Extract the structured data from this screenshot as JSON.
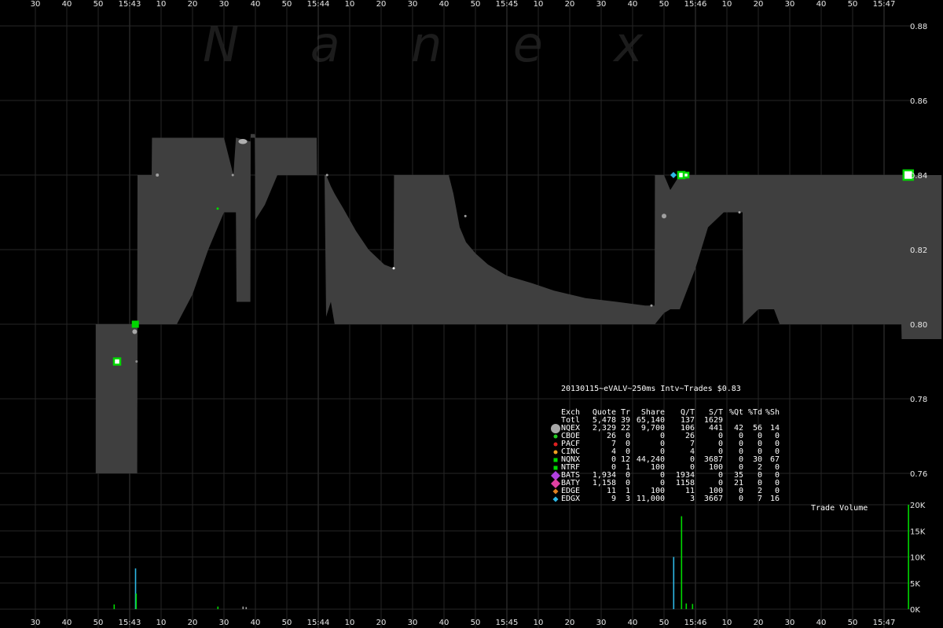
{
  "chart_data": [
    {
      "type": "area",
      "watermark": "N a n e x",
      "x_tick_labels": [
        "30",
        "40",
        "50",
        "15:43",
        "10",
        "20",
        "30",
        "40",
        "50",
        "15:44",
        "10",
        "20",
        "30",
        "40",
        "50",
        "15:45",
        "10",
        "20",
        "30",
        "40",
        "50",
        "15:46",
        "10",
        "20",
        "30",
        "40",
        "50",
        "15:47"
      ],
      "y_tick_labels": [
        "0.88",
        "0.86",
        "0.84",
        "0.82",
        "0.80",
        "0.78",
        "0.76"
      ],
      "ylim": [
        0.755,
        0.882
      ],
      "x_range_seconds": [
        -15,
        260
      ],
      "grid": true,
      "colors": {
        "band": "#3f3f3f",
        "grid": "#2a2a2a",
        "background": "#000000"
      },
      "nbbo_series": [
        {
          "t": -10.8,
          "bid": 0.76,
          "ask": 0.8
        },
        {
          "t": 2.4,
          "bid": 0.76,
          "ask": 0.8
        },
        {
          "t": 2.5,
          "bid": 0.8,
          "ask": 0.84
        },
        {
          "t": 7.0,
          "bid": 0.8,
          "ask": 0.84
        },
        {
          "t": 7.1,
          "bid": 0.8,
          "ask": 0.85
        },
        {
          "t": 15.0,
          "bid": 0.8,
          "ask": 0.85
        },
        {
          "t": 20.0,
          "bid": 0.808,
          "ask": 0.85
        },
        {
          "t": 25.0,
          "bid": 0.82,
          "ask": 0.85
        },
        {
          "t": 29.0,
          "bid": 0.828,
          "ask": 0.85
        },
        {
          "t": 30.0,
          "bid": 0.83,
          "ask": 0.85
        },
        {
          "t": 33.0,
          "bid": 0.83,
          "ask": 0.84
        },
        {
          "t": 33.8,
          "bid": 0.83,
          "ask": 0.85
        },
        {
          "t": 34.0,
          "bid": 0.806,
          "ask": 0.85
        },
        {
          "t": 38.4,
          "bid": 0.806,
          "ask": 0.849
        },
        {
          "t": 38.5,
          "bid": 0.85,
          "ask": 0.851
        },
        {
          "t": 39.8,
          "bid": 0.85,
          "ask": 0.851
        },
        {
          "t": 40.0,
          "bid": 0.828,
          "ask": 0.85
        },
        {
          "t": 43.0,
          "bid": 0.832,
          "ask": 0.85
        },
        {
          "t": 46.0,
          "bid": 0.838,
          "ask": 0.85
        },
        {
          "t": 47.0,
          "bid": 0.84,
          "ask": 0.85
        },
        {
          "t": 59.5,
          "bid": 0.84,
          "ask": 0.85
        },
        {
          "t": 59.6,
          "bid": 0.84,
          "ask": 0.84
        },
        {
          "t": 62.0,
          "bid": 0.84,
          "ask": 0.84
        },
        {
          "t": 62.5,
          "bid": 0.802,
          "ask": 0.84
        },
        {
          "t": 64.0,
          "bid": 0.806,
          "ask": 0.837
        },
        {
          "t": 65.2,
          "bid": 0.8,
          "ask": 0.835
        },
        {
          "t": 68.0,
          "bid": 0.8,
          "ask": 0.831
        },
        {
          "t": 72.0,
          "bid": 0.8,
          "ask": 0.825
        },
        {
          "t": 76.0,
          "bid": 0.8,
          "ask": 0.82
        },
        {
          "t": 81.0,
          "bid": 0.8,
          "ask": 0.816
        },
        {
          "t": 84.0,
          "bid": 0.8,
          "ask": 0.815
        },
        {
          "t": 84.1,
          "bid": 0.8,
          "ask": 0.84
        },
        {
          "t": 90.0,
          "bid": 0.8,
          "ask": 0.84
        },
        {
          "t": 95.0,
          "bid": 0.8,
          "ask": 0.84
        },
        {
          "t": 99.0,
          "bid": 0.8,
          "ask": 0.84
        },
        {
          "t": 101.5,
          "bid": 0.8,
          "ask": 0.84
        },
        {
          "t": 103.0,
          "bid": 0.8,
          "ask": 0.835
        },
        {
          "t": 105.0,
          "bid": 0.8,
          "ask": 0.826
        },
        {
          "t": 107.0,
          "bid": 0.8,
          "ask": 0.822
        },
        {
          "t": 110.0,
          "bid": 0.8,
          "ask": 0.819
        },
        {
          "t": 114.0,
          "bid": 0.8,
          "ask": 0.816
        },
        {
          "t": 120.0,
          "bid": 0.8,
          "ask": 0.813
        },
        {
          "t": 128.0,
          "bid": 0.8,
          "ask": 0.811
        },
        {
          "t": 135.0,
          "bid": 0.8,
          "ask": 0.809
        },
        {
          "t": 145.0,
          "bid": 0.8,
          "ask": 0.807
        },
        {
          "t": 155.0,
          "bid": 0.8,
          "ask": 0.806
        },
        {
          "t": 164.0,
          "bid": 0.8,
          "ask": 0.805
        },
        {
          "t": 167.0,
          "bid": 0.8,
          "ask": 0.805
        },
        {
          "t": 167.1,
          "bid": 0.8,
          "ask": 0.84
        },
        {
          "t": 170.0,
          "bid": 0.803,
          "ask": 0.84
        },
        {
          "t": 172.0,
          "bid": 0.804,
          "ask": 0.836
        },
        {
          "t": 175.0,
          "bid": 0.804,
          "ask": 0.84
        },
        {
          "t": 180.0,
          "bid": 0.815,
          "ask": 0.84
        },
        {
          "t": 184.0,
          "bid": 0.826,
          "ask": 0.84
        },
        {
          "t": 189.0,
          "bid": 0.83,
          "ask": 0.84
        },
        {
          "t": 195.0,
          "bid": 0.83,
          "ask": 0.84
        },
        {
          "t": 195.1,
          "bid": 0.8,
          "ask": 0.84
        },
        {
          "t": 200.0,
          "bid": 0.804,
          "ask": 0.84
        },
        {
          "t": 205.0,
          "bid": 0.804,
          "ask": 0.84
        },
        {
          "t": 206.8,
          "bid": 0.8,
          "ask": 0.84
        },
        {
          "t": 245.5,
          "bid": 0.8,
          "ask": 0.84
        },
        {
          "t": 245.6,
          "bid": 0.796,
          "ask": 0.84
        },
        {
          "t": 258.3,
          "bid": 0.796,
          "ask": 0.84
        }
      ],
      "trade_markers": [
        {
          "t": 1.8,
          "price": 0.8,
          "shape": "square",
          "color": "#00d800",
          "size": 9
        },
        {
          "t": 1.6,
          "price": 0.798,
          "shape": "circle",
          "color": "#a8a8a8",
          "size": 6
        },
        {
          "t": -4.0,
          "price": 0.79,
          "shape": "hollow-square",
          "color": "#00d800",
          "size": 8
        },
        {
          "t": 2.2,
          "price": 0.79,
          "shape": "circle",
          "color": "#909090",
          "size": 3
        },
        {
          "t": 8.8,
          "price": 0.84,
          "shape": "circle",
          "color": "#a0a0a0",
          "size": 4
        },
        {
          "t": 28.0,
          "price": 0.831,
          "shape": "circle",
          "color": "#00d800",
          "size": 3
        },
        {
          "t": 32.8,
          "price": 0.84,
          "shape": "circle",
          "color": "#a0a0a0",
          "size": 3
        },
        {
          "t": 36.0,
          "price": 0.849,
          "shape": "ellipse",
          "color": "#b0b0b0",
          "size": 8
        },
        {
          "t": 62.8,
          "price": 0.84,
          "shape": "circle",
          "color": "#a0a0a0",
          "size": 3
        },
        {
          "t": 84.0,
          "price": 0.815,
          "shape": "circle",
          "color": "#ffffff",
          "size": 3
        },
        {
          "t": 106.8,
          "price": 0.829,
          "shape": "circle",
          "color": "#a0a0a0",
          "size": 3
        },
        {
          "t": 166.0,
          "price": 0.805,
          "shape": "circle",
          "color": "#a0a0a0",
          "size": 3
        },
        {
          "t": 170.0,
          "price": 0.829,
          "shape": "circle",
          "color": "#a0a0a0",
          "size": 6
        },
        {
          "t": 173.0,
          "price": 0.84,
          "shape": "diamond",
          "color": "#2eb8e6",
          "size": 8
        },
        {
          "t": 175.5,
          "price": 0.84,
          "shape": "hollow-square",
          "color": "#00d800",
          "size": 8
        },
        {
          "t": 177.0,
          "price": 0.84,
          "shape": "hollow-square",
          "color": "#00d800",
          "size": 6
        },
        {
          "t": 194.0,
          "price": 0.83,
          "shape": "circle",
          "color": "#a0a0a0",
          "size": 3
        },
        {
          "t": 247.7,
          "price": 0.84,
          "shape": "hollow-square",
          "color": "#00d800",
          "size": 12
        }
      ]
    },
    {
      "type": "bar",
      "title": "Trade Volume",
      "y_tick_labels": [
        "20K",
        "15K",
        "10K",
        "5K",
        "0K"
      ],
      "ylim": [
        0,
        20000
      ],
      "bars": [
        {
          "t": -5.0,
          "v": 900,
          "color": "#00d800"
        },
        {
          "t": 1.8,
          "v": 7800,
          "color": "#2eb8e6"
        },
        {
          "t": 2.0,
          "v": 3000,
          "color": "#00d800"
        },
        {
          "t": 28.0,
          "v": 500,
          "color": "#00d800"
        },
        {
          "t": 36.0,
          "v": 500,
          "color": "#a0a0a0"
        },
        {
          "t": 37.0,
          "v": 400,
          "color": "#a0a0a0"
        },
        {
          "t": 173.0,
          "v": 10000,
          "color": "#2eb8e6"
        },
        {
          "t": 175.5,
          "v": 17800,
          "color": "#00d800"
        },
        {
          "t": 177.0,
          "v": 1100,
          "color": "#00d800"
        },
        {
          "t": 179.0,
          "v": 1000,
          "color": "#00d800"
        },
        {
          "t": 247.7,
          "v": 20000,
          "color": "#00d800"
        }
      ]
    }
  ],
  "stats": {
    "title": "20130115~eVALV~250ms Intv~Trades $0.83",
    "header": [
      "Exch",
      "Quote",
      "Tr",
      "Share",
      "Q/T",
      "S/T",
      "%Qt",
      "%Td",
      "%Sh"
    ],
    "rows": [
      {
        "symbol": "none",
        "color": "",
        "cells": [
          "Totl",
          "5,478",
          "39",
          "65,140",
          "137",
          "1629",
          "",
          "",
          ""
        ]
      },
      {
        "symbol": "circle-large",
        "color": "#a8a8a8",
        "cells": [
          "NQEX",
          "2,329",
          "22",
          "9,700",
          "106",
          "441",
          "42",
          "56",
          "14"
        ]
      },
      {
        "symbol": "dot",
        "color": "#22cc22",
        "cells": [
          "CBOE",
          "26",
          "0",
          "0",
          "26",
          "0",
          "0",
          "0",
          "0"
        ]
      },
      {
        "symbol": "dot",
        "color": "#e02020",
        "cells": [
          "PACF",
          "7",
          "0",
          "0",
          "7",
          "0",
          "0",
          "0",
          "0"
        ]
      },
      {
        "symbol": "dot",
        "color": "#f0a020",
        "cells": [
          "CINC",
          "4",
          "0",
          "0",
          "4",
          "0",
          "0",
          "0",
          "0"
        ]
      },
      {
        "symbol": "square",
        "color": "#00d800",
        "cells": [
          "NQNX",
          "0",
          "12",
          "44,240",
          "0",
          "3687",
          "0",
          "30",
          "67"
        ]
      },
      {
        "symbol": "square",
        "color": "#00d800",
        "cells": [
          "NTRF",
          "0",
          "1",
          "100",
          "0",
          "100",
          "0",
          "2",
          "0"
        ]
      },
      {
        "symbol": "diamond",
        "color": "#b040e0",
        "cells": [
          "BATS",
          "1,934",
          "0",
          "0",
          "1934",
          "0",
          "35",
          "0",
          "0"
        ]
      },
      {
        "symbol": "diamond",
        "color": "#e040a0",
        "cells": [
          "BATY",
          "1,158",
          "0",
          "0",
          "1158",
          "0",
          "21",
          "0",
          "0"
        ]
      },
      {
        "symbol": "diamond-small",
        "color": "#e08020",
        "cells": [
          "EDGE",
          "11",
          "1",
          "100",
          "11",
          "100",
          "0",
          "2",
          "0"
        ]
      },
      {
        "symbol": "diamond-small",
        "color": "#2eb8e6",
        "cells": [
          "EDGX",
          "9",
          "3",
          "11,000",
          "3",
          "3667",
          "0",
          "7",
          "16"
        ]
      }
    ]
  }
}
